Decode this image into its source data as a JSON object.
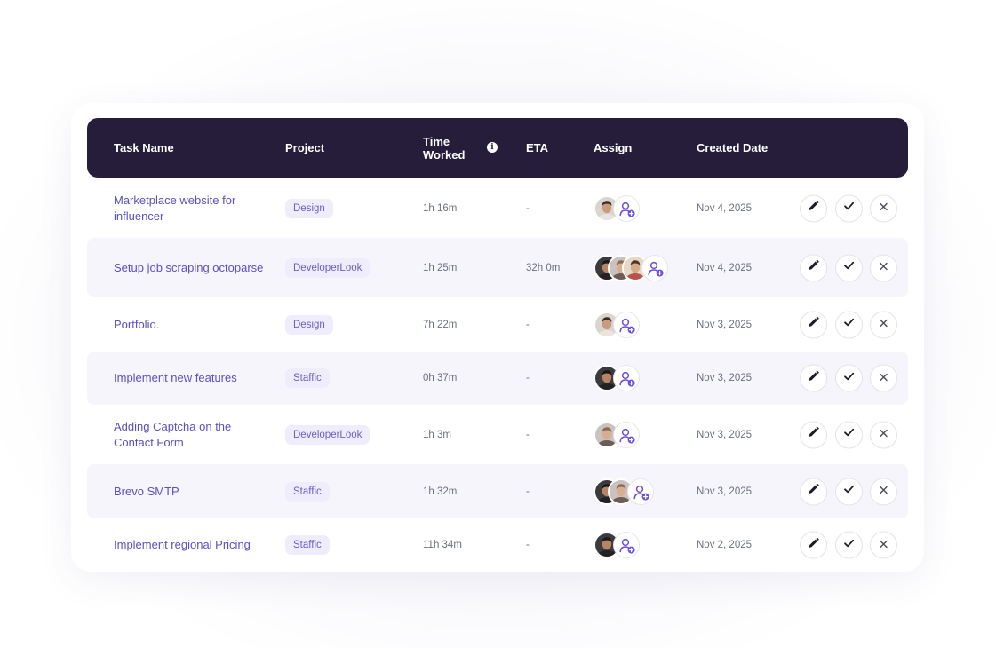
{
  "columns": {
    "task_name": "Task Name",
    "project": "Project",
    "time_worked": "Time Worked",
    "eta": "ETA",
    "assign": "Assign",
    "created_date": "Created Date"
  },
  "colors": {
    "header_bg": "#261d3b",
    "task_text": "#5b4fc2",
    "badge_bg": "#efecfb",
    "badge_text": "#6a5fc8",
    "accent": "#6c4ce0"
  },
  "rows": [
    {
      "task": "Marketplace website for influencer",
      "project": "Design",
      "time": "1h 16m",
      "eta": "-",
      "created": "Nov 4, 2025",
      "avatars": [
        "person-a"
      ]
    },
    {
      "task": "Setup job scraping octoparse",
      "project": "DeveloperLook",
      "time": "1h 25m",
      "eta": "32h 0m",
      "created": "Nov 4, 2025",
      "avatars": [
        "person-b",
        "person-c",
        "person-d"
      ]
    },
    {
      "task": "Portfolio.",
      "project": "Design",
      "time": "7h 22m",
      "eta": "-",
      "created": "Nov 3, 2025",
      "avatars": [
        "person-a"
      ]
    },
    {
      "task": "Implement new features",
      "project": "Staffic",
      "time": "0h 37m",
      "eta": "-",
      "created": "Nov 3, 2025",
      "avatars": [
        "person-b"
      ]
    },
    {
      "task": "Adding Captcha on the Contact Form",
      "project": "DeveloperLook",
      "time": "1h 3m",
      "eta": "-",
      "created": "Nov 3, 2025",
      "avatars": [
        "person-c"
      ]
    },
    {
      "task": "Brevo SMTP",
      "project": "Staffic",
      "time": "1h 32m",
      "eta": "-",
      "created": "Nov 3, 2025",
      "avatars": [
        "person-b",
        "person-c"
      ]
    },
    {
      "task": "Implement regional Pricing",
      "project": "Staffic",
      "time": "11h 34m",
      "eta": "-",
      "created": "Nov 2, 2025",
      "avatars": [
        "person-b"
      ]
    }
  ]
}
